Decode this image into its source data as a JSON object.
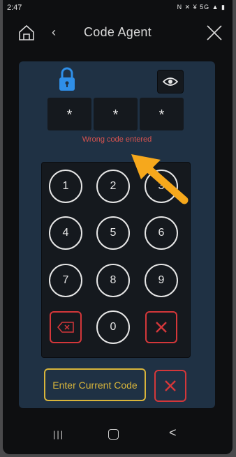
{
  "status_bar": {
    "time": "2:47",
    "icons": "N ✕ ¥ 5G ▲ ▮"
  },
  "header": {
    "back_glyph": "‹",
    "title": "Code Agent"
  },
  "code_entry": {
    "slots": [
      "*",
      "*",
      "*"
    ],
    "error_text": "Wrong code entered"
  },
  "keypad": {
    "keys": [
      "1",
      "2",
      "3",
      "4",
      "5",
      "6",
      "7",
      "8",
      "9",
      "0"
    ]
  },
  "buttons": {
    "enter_current_code": "Enter Current Code"
  },
  "colors": {
    "panel": "#1f3144",
    "error": "#d9534f",
    "accent_yellow": "#d8b53b",
    "danger_red": "#d4373a",
    "lock_blue": "#2f8fe8",
    "arrow_orange": "#f6a81c"
  },
  "nav": {
    "recent": "|||",
    "back": "<"
  }
}
